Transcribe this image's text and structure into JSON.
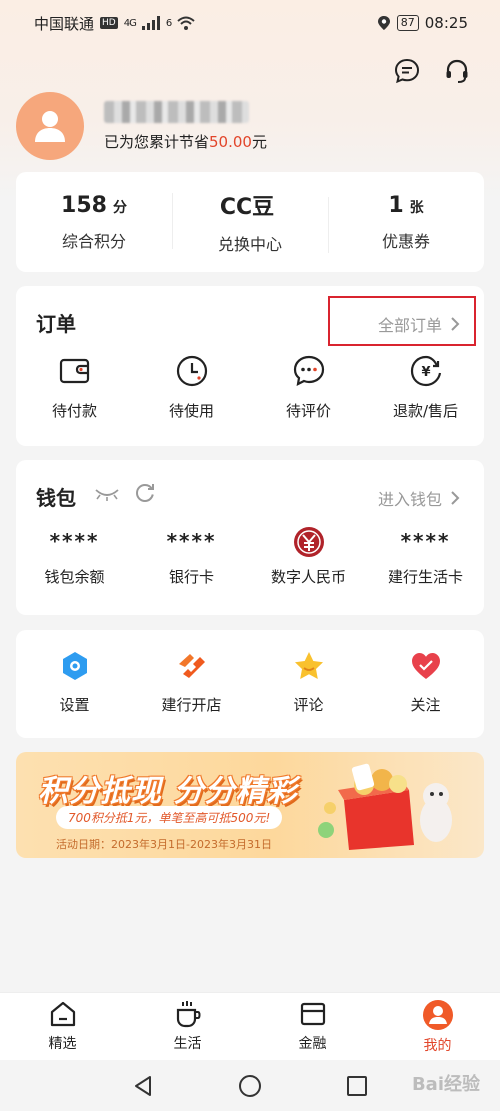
{
  "status_bar": {
    "carrier": "中国联通",
    "hd": "HD",
    "network": "4G",
    "wifi_sup": "6",
    "battery": "87",
    "time": "08:25"
  },
  "profile": {
    "savings_prefix": "已为您累计节省",
    "savings_amount": "50.00",
    "savings_suffix": "元"
  },
  "stats": [
    {
      "value": "158",
      "unit": "分",
      "label": "综合积分"
    },
    {
      "value": "CC豆",
      "unit": "",
      "label": "兑换中心"
    },
    {
      "value": "1",
      "unit": "张",
      "label": "优惠券"
    }
  ],
  "orders": {
    "title": "订单",
    "all_link": "全部订单",
    "items": [
      {
        "label": "待付款",
        "icon": "wallet-icon"
      },
      {
        "label": "待使用",
        "icon": "clock-icon"
      },
      {
        "label": "待评价",
        "icon": "chat-dots-icon"
      },
      {
        "label": "退款/售后",
        "icon": "refund-icon"
      }
    ]
  },
  "wallet": {
    "title": "钱包",
    "enter_link": "进入钱包",
    "items": [
      {
        "value": "****",
        "label": "钱包余额"
      },
      {
        "value": "****",
        "label": "银行卡"
      },
      {
        "value": "",
        "label": "数字人民币"
      },
      {
        "value": "****",
        "label": "建行生活卡"
      }
    ]
  },
  "tools": [
    {
      "label": "设置",
      "icon": "settings-icon"
    },
    {
      "label": "建行开店",
      "icon": "store-icon"
    },
    {
      "label": "评论",
      "icon": "star-icon"
    },
    {
      "label": "关注",
      "icon": "heart-icon"
    }
  ],
  "banner": {
    "title": "积分抵现 分分精彩",
    "subtitle": "700积分抵1元，单笔至高可抵500元!",
    "date": "活动日期：2023年3月1日-2023年3月31日"
  },
  "tabs": [
    {
      "label": "精选",
      "icon": "home-icon"
    },
    {
      "label": "生活",
      "icon": "coffee-icon"
    },
    {
      "label": "金融",
      "icon": "card-icon"
    },
    {
      "label": "我的",
      "icon": "profile-icon"
    }
  ],
  "active_tab": "我的",
  "watermark": "Bai经验",
  "colors": {
    "accent": "#e2452a",
    "highlight_box": "#d9242f",
    "avatar": "#f6a77c"
  }
}
